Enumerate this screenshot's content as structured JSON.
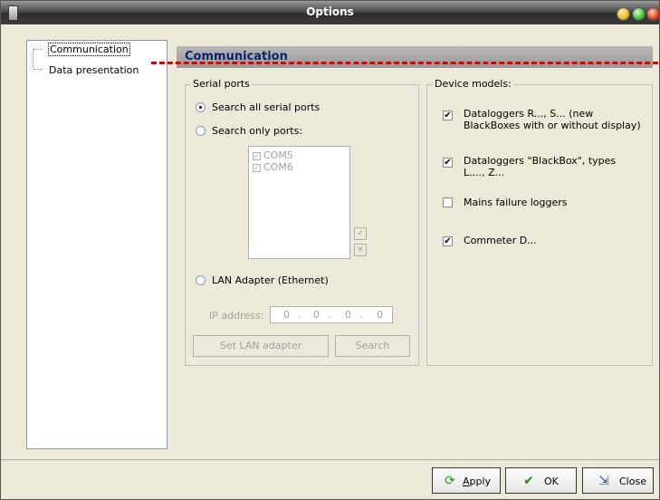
{
  "window": {
    "title": "Options"
  },
  "tree": {
    "items": [
      "Communication",
      "Data presentation"
    ]
  },
  "header": {
    "title": "Communication"
  },
  "serial_ports": {
    "legend": "Serial ports",
    "option_all": "Search all serial ports",
    "option_only": "Search only ports:",
    "selected": "Search all serial ports",
    "ports": [
      "COM5",
      "COM6"
    ],
    "check_all_symbol": "✓",
    "uncheck_all_symbol": "✕",
    "option_lan": "LAN Adapter (Ethernet)",
    "ip_label": "IP address:",
    "ip_octets": [
      "0",
      "0",
      "0",
      "0"
    ],
    "ip_dot": ".",
    "set_lan_button": "Set LAN adapter",
    "search_button": "Search"
  },
  "device_models": {
    "legend": "Device models:",
    "items": [
      {
        "label": "Dataloggers R..., S... (new BlackBoxes with or without display)",
        "checked": true
      },
      {
        "label": "Dataloggers \"BlackBox\", types L...., Z...",
        "checked": true
      },
      {
        "label": "Mains failure loggers",
        "checked": false
      },
      {
        "label": "Commeter D...",
        "checked": true
      }
    ],
    "check_mark": "✔"
  },
  "footer": {
    "apply_prefix": "A",
    "apply_rest": "pply",
    "ok": "OK",
    "close": "Close"
  },
  "icons": {
    "apply": "refresh-arrows-icon",
    "ok": "green-check-icon",
    "close": "door-exit-icon"
  },
  "colors": {
    "header_text": "#0a246a",
    "annotation_dash": "#e00000"
  }
}
